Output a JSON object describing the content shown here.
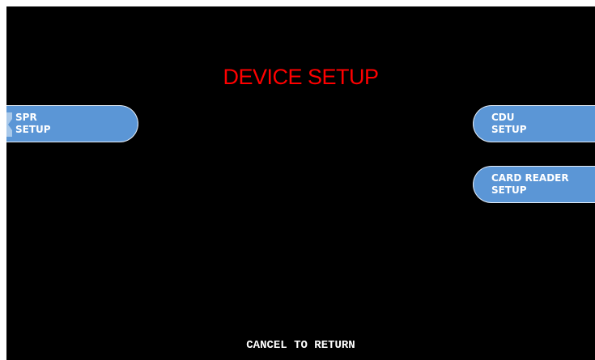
{
  "screen": {
    "title": "DEVICE SETUP",
    "title_color": "#ff0000",
    "background": "#000000",
    "button_color": "#5b96d6",
    "footer": "CANCEL TO RETURN"
  },
  "left_keys": [
    {
      "line1": "SPR",
      "line2": "SETUP"
    }
  ],
  "right_keys": [
    {
      "line1": "CDU",
      "line2": "SETUP"
    },
    {
      "line1": "CARD READER",
      "line2": "SETUP"
    }
  ]
}
